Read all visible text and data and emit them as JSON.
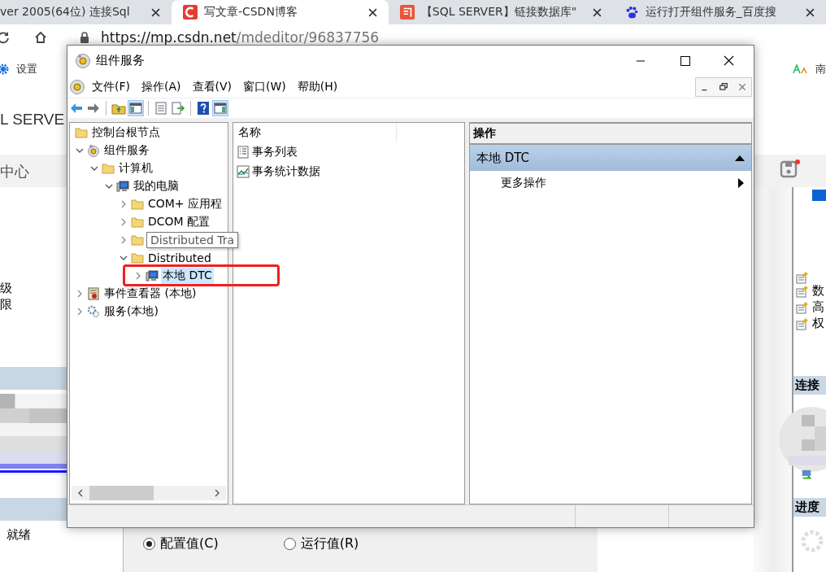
{
  "browser": {
    "tabs": [
      {
        "label": "ver 2005(64位) 连接Sql",
        "selected": false
      },
      {
        "label": "写文章-CSDN博客",
        "selected": true
      },
      {
        "label": "【SQL SERVER】链接数据库\"",
        "selected": false
      },
      {
        "label": "运行打开组件服务_百度搜",
        "selected": false
      }
    ],
    "url_host": "https://mp.csdn.net",
    "url_path": "/mdeditor/96837756",
    "bookmarks": [
      "设置",
      "南"
    ],
    "page": {
      "title": "L SERVE",
      "nav_label": "中心",
      "left_lines": [
        "级",
        "限"
      ],
      "status": "就绪",
      "radios": [
        {
          "label": "配置值(C)",
          "selected": true
        },
        {
          "label": "运行值(R)",
          "selected": false
        }
      ],
      "right_items": [
        "数",
        "高",
        "权"
      ],
      "right_headers": [
        "连接",
        "进度"
      ]
    }
  },
  "window": {
    "title": "组件服务",
    "menu": [
      "文件(F)",
      "操作(A)",
      "查看(V)",
      "窗口(W)",
      "帮助(H)"
    ],
    "tree": [
      {
        "label": "控制台根节点",
        "kind": "folder",
        "selected": false,
        "children": [
          {
            "label": "组件服务",
            "kind": "snapin",
            "expanded": true,
            "selected": false,
            "children": [
              {
                "label": "计算机",
                "kind": "folder",
                "expanded": true,
                "selected": false,
                "children": [
                  {
                    "label": "我的电脑",
                    "kind": "computer",
                    "expanded": true,
                    "selected": false,
                    "children": [
                      {
                        "label": "COM+ 应用程",
                        "kind": "folder",
                        "expanded": false,
                        "selected": false
                      },
                      {
                        "label": "DCOM 配置",
                        "kind": "folder",
                        "expanded": false,
                        "selected": false
                      },
                      {
                        "kind": "folder",
                        "expanded": false
                      },
                      {
                        "label": "Distributed",
                        "kind": "folder",
                        "expanded": true,
                        "selected": false,
                        "children": [
                          {
                            "label": "本地 DTC",
                            "kind": "computer",
                            "expanded": false,
                            "selected": true
                          }
                        ]
                      }
                    ]
                  }
                ]
              }
            ]
          },
          {
            "label": "事件查看器 (本地)",
            "kind": "event",
            "expanded": false,
            "selected": false
          },
          {
            "label": "服务(本地)",
            "kind": "gear",
            "expanded": false,
            "selected": false
          }
        ]
      }
    ],
    "tooltip": "Distributed Tra",
    "list_column": "名称",
    "list_items": [
      {
        "label": "事务列表",
        "kind": "list"
      },
      {
        "label": "事务统计数据",
        "kind": "chart"
      }
    ],
    "actions": {
      "title": "操作",
      "sections": [
        {
          "label": "本地 DTC",
          "expanded": true,
          "items": [
            "更多操作"
          ]
        }
      ]
    }
  }
}
